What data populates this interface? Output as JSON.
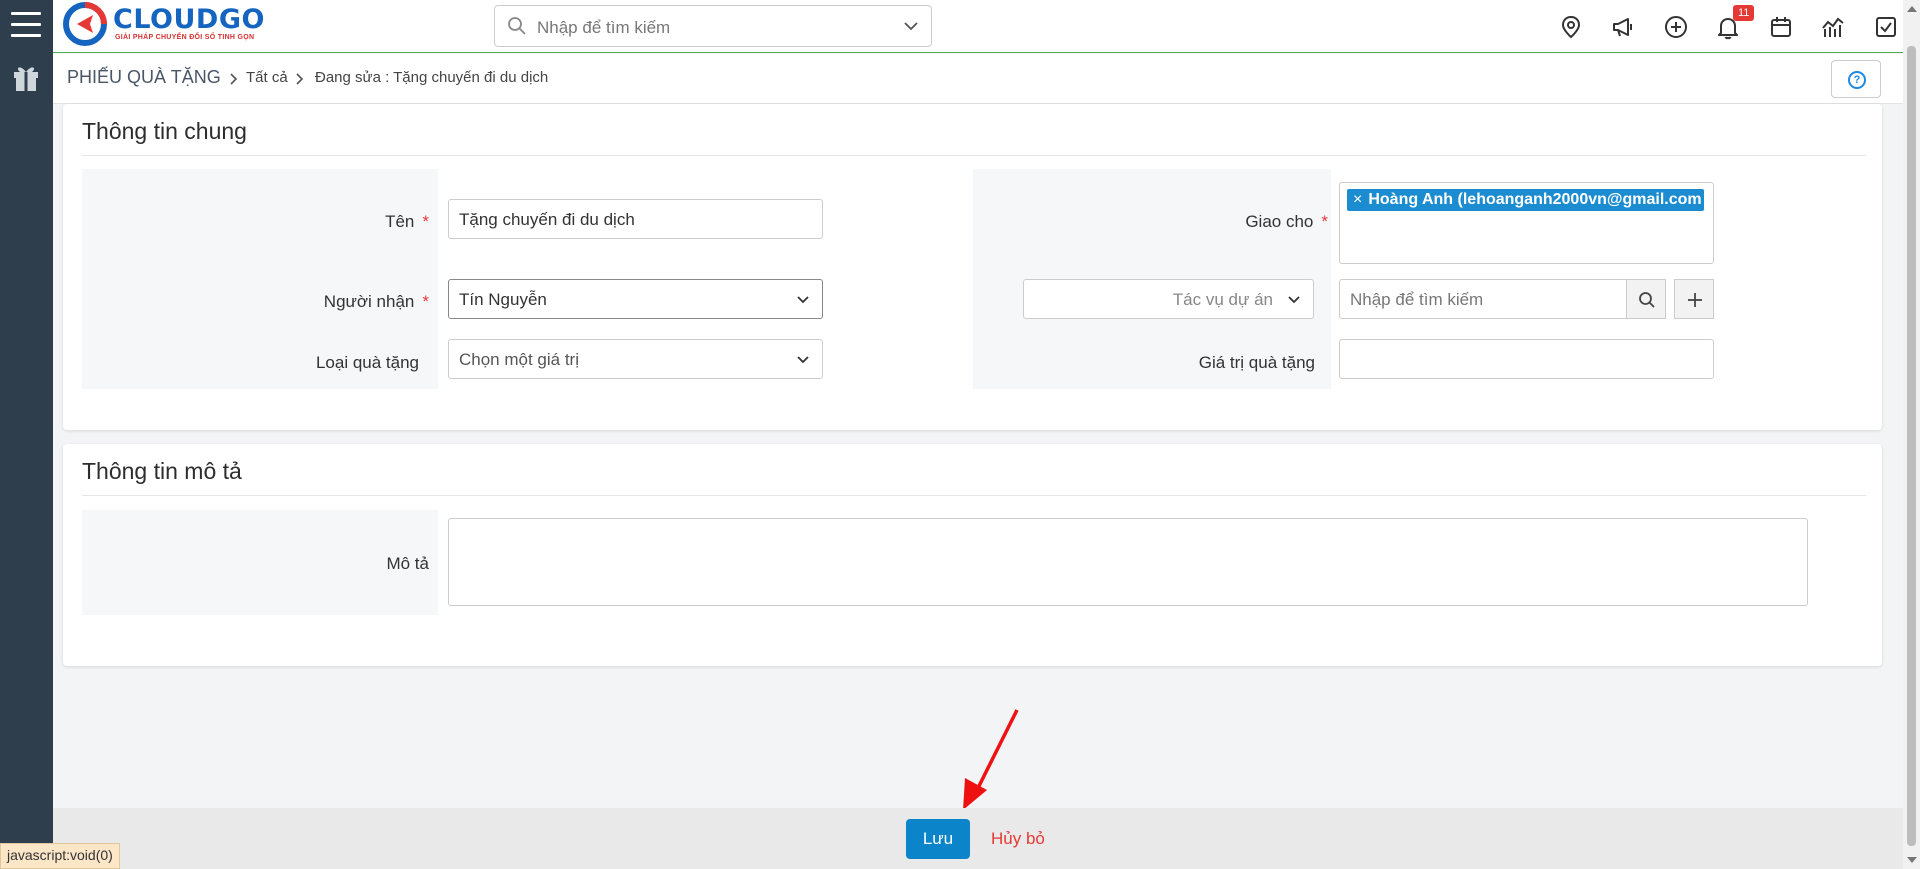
{
  "brand": {
    "name": "CLOUDGO",
    "tagline": "GIẢI PHÁP CHUYỂN ĐỔI SỐ TINH GỌN"
  },
  "search": {
    "placeholder": "Nhập để tìm kiếm"
  },
  "notifications": {
    "count": "11"
  },
  "breadcrumb": {
    "module": "PHIẾU QUÀ TẶNG",
    "level1": "Tất cả",
    "current": "Đang sửa : Tặng chuyến đi du dịch"
  },
  "sections": {
    "general": {
      "title": "Thông tin chung"
    },
    "description": {
      "title": "Thông tin mô tả"
    }
  },
  "form": {
    "name": {
      "label": "Tên",
      "required": "*",
      "value": "Tặng chuyến đi du dịch"
    },
    "recipient": {
      "label": "Người nhận",
      "required": "*",
      "value": "Tín Nguyễn"
    },
    "gift_type": {
      "label": "Loại quà tặng",
      "value": "Chọn một giá trị"
    },
    "assigned_to": {
      "label": "Giao cho",
      "required": "*",
      "tag": "Hoàng Anh (lehoanganh2000vn@gmail.com",
      "remove": "×"
    },
    "project_task": {
      "value": "Tác vụ dự án"
    },
    "related_search": {
      "placeholder": "Nhập để tìm kiếm"
    },
    "gift_value": {
      "label": "Giá trị quà tặng",
      "value": ""
    },
    "description": {
      "label": "Mô tả",
      "value": ""
    }
  },
  "footer": {
    "save_label": "Lưu",
    "cancel_label": "Hủy bỏ"
  },
  "status_bar": {
    "url": "javascript:void(0)"
  },
  "colors": {
    "primary": "#0b84c9",
    "required": "#e53935",
    "sidebar": "#2f3e4c",
    "tag": "#1c8cd0"
  }
}
